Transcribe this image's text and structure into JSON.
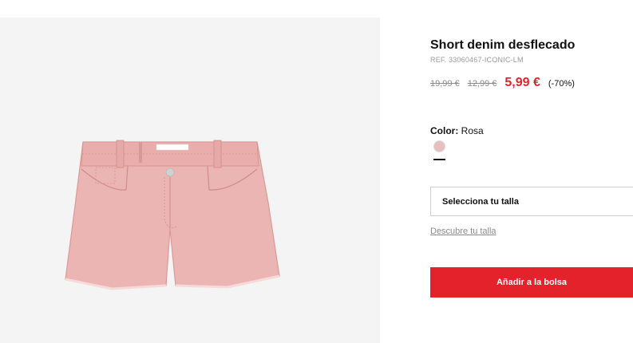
{
  "product": {
    "title": "Short denim desflecado",
    "reference": "REF. 33060467-ICONIC-LM",
    "original_price": "19,99 €",
    "previous_price": "12,99 €",
    "sale_price": "5,99 €",
    "discount": "(-70%)",
    "image_description_icon": "pink-denim-shorts-image"
  },
  "color": {
    "label": "Color:",
    "value": "Rosa",
    "swatch_color": "#e8bfc0"
  },
  "size": {
    "select_label": "Selecciona tu talla",
    "guide_link": "Descubre tu talla"
  },
  "actions": {
    "add_to_bag": "Añadir a la bolsa"
  },
  "colors": {
    "accent": "#e3222b",
    "image_background": "#f4f4f4"
  }
}
